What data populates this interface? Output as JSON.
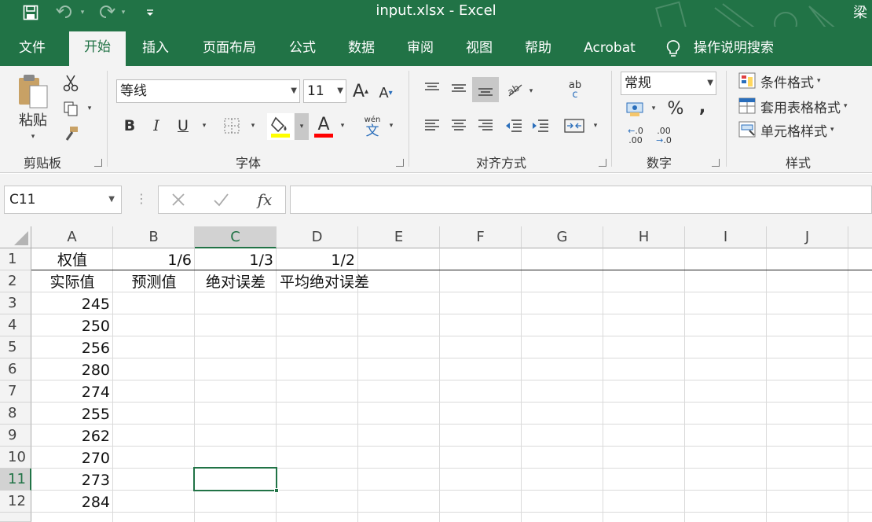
{
  "titlebar": {
    "title": "input.xlsx  -  Excel",
    "user": "梁"
  },
  "tabs": [
    "文件",
    "开始",
    "插入",
    "页面布局",
    "公式",
    "数据",
    "审阅",
    "视图",
    "帮助",
    "Acrobat",
    "操作说明搜索"
  ],
  "active_tab": "开始",
  "ribbon": {
    "clipboard": {
      "paste_label": "粘贴",
      "group_label": "剪贴板"
    },
    "font": {
      "font_name": "等线",
      "font_size": "11",
      "group_label": "字体",
      "increase_label": "A",
      "decrease_label": "A",
      "bold": "B",
      "italic": "I",
      "underline": "U",
      "font_color_label": "A",
      "phonetic_top": "wén",
      "phonetic_bottom": "文"
    },
    "alignment": {
      "group_label": "对齐方式",
      "wrap_top": "ab",
      "wrap_bottom": "c"
    },
    "number": {
      "format": "常规",
      "group_label": "数字",
      "percent": "%",
      "comma": ",",
      "inc_dec_top": ".0",
      "inc_dec_bottom": ".00"
    },
    "styles": {
      "conditional": "条件格式",
      "table": "套用表格格式",
      "cell": "单元格样式",
      "group_label": "样式"
    }
  },
  "formula_bar": {
    "name_box": "C11",
    "fx": "fx",
    "content": ""
  },
  "sheet": {
    "columns": [
      "A",
      "B",
      "C",
      "D",
      "E",
      "F",
      "G",
      "H",
      "I",
      "J"
    ],
    "rows": [
      "1",
      "2",
      "3",
      "4",
      "5",
      "6",
      "7",
      "8",
      "9",
      "10",
      "11",
      "12"
    ],
    "selected_cell": "C11",
    "cells": {
      "A1": "权值",
      "B1": "1/6",
      "C1": "1/3",
      "D1": "1/2",
      "A2": "实际值",
      "B2": "预测值",
      "C2": "绝对误差",
      "D2": "平均绝对误差",
      "A3": "245",
      "A4": "250",
      "A5": "256",
      "A6": "280",
      "A7": "274",
      "A8": "255",
      "A9": "262",
      "A10": "270",
      "A11": "273",
      "A12": "284"
    }
  },
  "colors": {
    "brand": "#217346",
    "ribbon_bg": "#f3f3f3",
    "highlight_yellow": "#ffff00",
    "font_red": "#ff0000"
  }
}
